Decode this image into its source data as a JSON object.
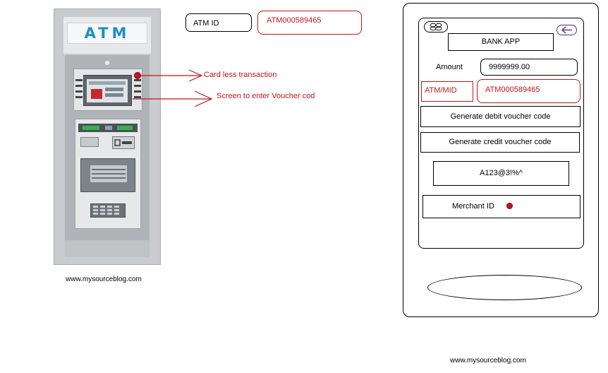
{
  "atm": {
    "sign_text": "ATM",
    "id_label": "ATM ID",
    "id_value": "ATM000589465",
    "callouts": {
      "card_less": "Card less transaction",
      "voucher_screen": "Screen to enter Voucher cod"
    },
    "website": "www.mysourceblog.com"
  },
  "phone": {
    "app_title": "BANK APP",
    "amount_label": "Amount",
    "amount_value": "9999999.00",
    "mid_label": "ATM/MID",
    "mid_value": "ATM000589465",
    "debit_button": "Generate debit voucher code",
    "credit_button": "Generate credit voucher code",
    "voucher_code": "A123@3!%^",
    "merchant_label": "Merchant ID",
    "website": "www.mysourceblog.com"
  },
  "colors": {
    "accent_red": "#c4151c",
    "atm_sign_blue": "#1f8fc4",
    "led_green": "#35b24a"
  },
  "icons": [
    "menu-icon",
    "back-arrow-icon",
    "red-dot-marker"
  ]
}
